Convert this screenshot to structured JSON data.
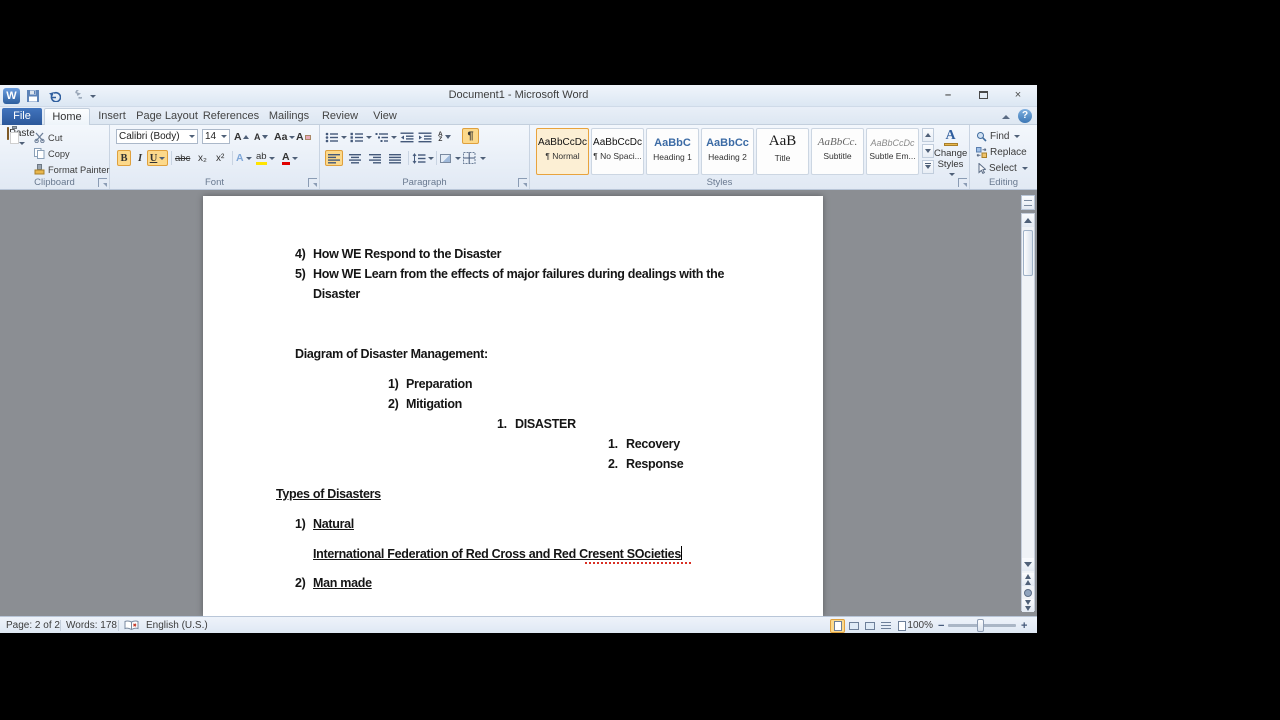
{
  "window": {
    "title": "Document1  -  Microsoft Word",
    "logo": "W",
    "controls": {
      "minimize": "–",
      "close": "×"
    }
  },
  "tabs": {
    "file": "File",
    "items": [
      "Home",
      "Insert",
      "Page Layout",
      "References",
      "Mailings",
      "Review",
      "View"
    ],
    "help": "?"
  },
  "ribbon": {
    "clipboard": {
      "label": "Clipboard",
      "paste": "Paste",
      "cut": "Cut",
      "copy": "Copy",
      "format_painter": "Format Painter"
    },
    "font": {
      "label": "Font",
      "family": "Calibri (Body)",
      "size": "14",
      "icons": {
        "bold": "B",
        "italic": "I",
        "underline": "U",
        "strike": "abc",
        "sub": "x₂",
        "sup": "x²",
        "grow": "A",
        "shrink": "A",
        "case": "Aa",
        "clear": "A",
        "effects": "A",
        "highlight": "ab",
        "color": "A"
      }
    },
    "paragraph": {
      "label": "Paragraph",
      "pilcrow": "¶",
      "sort_a": "A",
      "sort_z": "Z"
    },
    "styles": {
      "label": "Styles",
      "gallery": [
        {
          "preview": "AaBbCcDc",
          "name": "¶ Normal"
        },
        {
          "preview": "AaBbCcDc",
          "name": "¶ No Spaci..."
        },
        {
          "preview": "AaBbC",
          "name": "Heading 1"
        },
        {
          "preview": "AaBbCc",
          "name": "Heading 2"
        },
        {
          "preview": "AaB",
          "name": "Title"
        },
        {
          "preview": "AaBbCc.",
          "name": "Subtitle"
        },
        {
          "preview": "AaBbCcDc",
          "name": "Subtle Em..."
        }
      ],
      "change_line1": "Change",
      "change_line2": "Styles"
    },
    "editing": {
      "label": "Editing",
      "find": "Find",
      "replace": "Replace",
      "select": "Select"
    }
  },
  "document": {
    "lines": [
      {
        "num": "4)",
        "text": "How WE Respond to the Disaster"
      },
      {
        "num": "5)",
        "text": "How WE Learn from the effects of major failures during dealings with the"
      },
      {
        "num": "",
        "text": "Disaster"
      },
      {
        "num": "",
        "text": "Diagram of Disaster Management:"
      },
      {
        "num": "1)",
        "text": "Preparation"
      },
      {
        "num": "2)",
        "text": "Mitigation"
      },
      {
        "num": "1.",
        "text": "DISASTER"
      },
      {
        "num": "1.",
        "text": "Recovery"
      },
      {
        "num": "2.",
        "text": "Response"
      },
      {
        "num": "",
        "text": "Types of Disasters"
      },
      {
        "num": "1)",
        "text": "Natural"
      },
      {
        "num": "",
        "text": "International Federation of Red Cross and Red Cresent SOcieties"
      },
      {
        "num": "2)",
        "text": "Man made"
      }
    ]
  },
  "status": {
    "page": "Page: 2 of 2",
    "words": "Words: 178",
    "language": "English (U.S.)",
    "zoom": "100%",
    "zoom_out": "−",
    "zoom_in": "+"
  }
}
